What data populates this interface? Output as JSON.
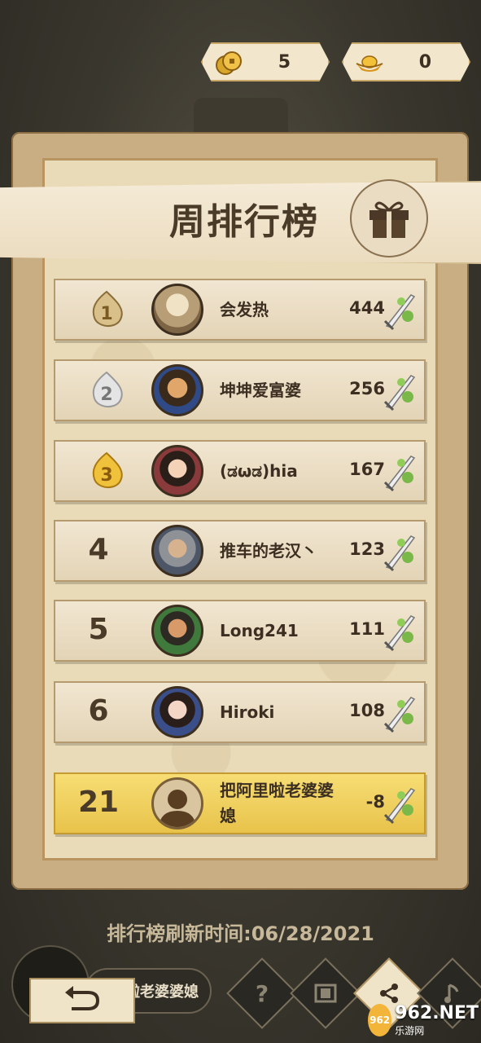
{
  "currency": {
    "coins": "5",
    "ingots": "0"
  },
  "title": "周排行榜",
  "rows": [
    {
      "rank": "1",
      "name": "会发热",
      "score": "444"
    },
    {
      "rank": "2",
      "name": "坤坤爱富婆",
      "score": "256"
    },
    {
      "rank": "3",
      "name": "(ಡωಡ)hia",
      "score": "167"
    },
    {
      "rank": "4",
      "name": "推车的老汉丶",
      "score": "123"
    },
    {
      "rank": "5",
      "name": "Long241",
      "score": "111"
    },
    {
      "rank": "6",
      "name": "Hiroki",
      "score": "108"
    }
  ],
  "me": {
    "rank": "21",
    "name": "把阿里啦老婆婆媳",
    "score": "-8"
  },
  "refresh_text": "排行榜刷新时间:06/28/2021",
  "bottom": {
    "player_name": "啦老婆婆媳",
    "help_label": "?"
  },
  "watermark": {
    "brand": "962.NET",
    "sub": "乐游网"
  },
  "colors": {
    "gold": "#e8c34b",
    "panel": "#c9ad83",
    "parchment": "#eadbb8"
  },
  "icons": [
    "coin-icon",
    "ingot-icon",
    "gift-icon",
    "sword-icon",
    "back-arrow-icon",
    "help-icon",
    "video-icon",
    "share-icon",
    "music-icon"
  ]
}
